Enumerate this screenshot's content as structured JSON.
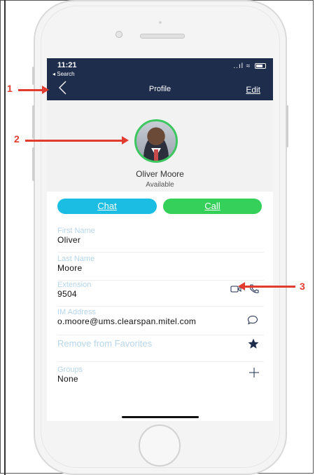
{
  "status_bar": {
    "time": "11:21",
    "back_label": "◂ Search",
    "signal_wifi": "..ıl ≈"
  },
  "nav": {
    "title": "Profile",
    "edit_label": "Edit"
  },
  "profile": {
    "name": "Oliver Moore",
    "status": "Available"
  },
  "actions": {
    "chat_label": "Chat",
    "call_label": "Call"
  },
  "fields": {
    "first_name_label": "First Name",
    "first_name_value": "Oliver",
    "last_name_label": "Last Name",
    "last_name_value": "Moore",
    "extension_label": "Extension",
    "extension_value": "9504",
    "im_label": "IM Address",
    "im_value": "o.moore@ums.clearspan.mitel.com",
    "favorites_label": "Remove from Favorites",
    "groups_label": "Groups",
    "groups_value": "None"
  },
  "callouts": {
    "one": "1",
    "two": "2",
    "three": "3"
  },
  "colors": {
    "nav_bg": "#1f2d4d",
    "chat": "#1bbde3",
    "call": "#35d05a",
    "presence": "#3cc760",
    "callout": "#e23b2f"
  }
}
